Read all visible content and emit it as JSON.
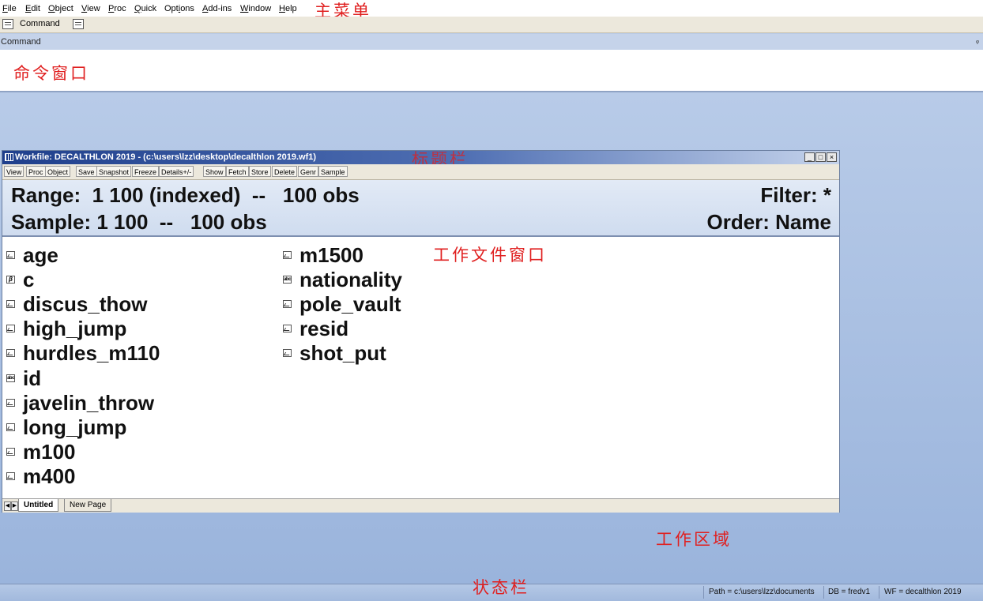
{
  "menu": {
    "items": [
      {
        "acc": "F",
        "rest": "ile"
      },
      {
        "acc": "E",
        "rest": "dit"
      },
      {
        "acc": "O",
        "rest": "bject"
      },
      {
        "acc": "V",
        "rest": "iew"
      },
      {
        "acc": "P",
        "rest": "roc"
      },
      {
        "acc": "Q",
        "rest": "uick"
      },
      {
        "pre": "Opt",
        "acc": "i",
        "rest": "ons"
      },
      {
        "acc": "A",
        "rest": "dd-ins"
      },
      {
        "acc": "W",
        "rest": "indow"
      },
      {
        "acc": "H",
        "rest": "elp"
      }
    ]
  },
  "annotations": {
    "main_menu": "主菜单",
    "command_window": "命令窗口",
    "title_bar": "标题栏",
    "workfile_window": "工作文件窗口",
    "work_area": "工作区域",
    "status_bar": "状态栏"
  },
  "command_bar": {
    "label": "Command"
  },
  "command_window": {
    "title": "Command",
    "pin": "ᵩ"
  },
  "workfile": {
    "title": "Workfile: DECALTHLON 2019 - (c:\\users\\lzz\\desktop\\decalthlon 2019.wf1)",
    "toolbar": [
      "View",
      "Proc",
      "Object",
      "Save",
      "Snapshot",
      "Freeze",
      "Details+/-",
      "Show",
      "Fetch",
      "Store",
      "Delete",
      "Genr",
      "Sample"
    ],
    "range_line": "Range:  1 100 (indexed)  --   100 obs",
    "sample_line": "Sample: 1 100  --   100 obs",
    "filter_line": "Filter: *",
    "order_line": "Order: Name",
    "objects_col1": [
      {
        "name": "age",
        "type": "series"
      },
      {
        "name": "c",
        "type": "coef"
      },
      {
        "name": "discus_thow",
        "type": "series"
      },
      {
        "name": "high_jump",
        "type": "series"
      },
      {
        "name": "hurdles_m110",
        "type": "series"
      },
      {
        "name": "id",
        "type": "alpha"
      },
      {
        "name": "javelin_throw",
        "type": "series"
      },
      {
        "name": "long_jump",
        "type": "series"
      },
      {
        "name": "m100",
        "type": "series"
      },
      {
        "name": "m400",
        "type": "series"
      }
    ],
    "objects_col2": [
      {
        "name": "m1500",
        "type": "series"
      },
      {
        "name": "nationality",
        "type": "alpha"
      },
      {
        "name": "pole_vault",
        "type": "series"
      },
      {
        "name": "resid",
        "type": "series"
      },
      {
        "name": "shot_put",
        "type": "series"
      }
    ],
    "tabs": [
      "Untitled",
      "New Page"
    ],
    "window_buttons": [
      "_",
      "□",
      "×"
    ]
  },
  "status": {
    "path": "Path = c:\\users\\lzz\\documents",
    "db": "DB = fredv1",
    "wf": "WF = decalthlon 2019"
  }
}
